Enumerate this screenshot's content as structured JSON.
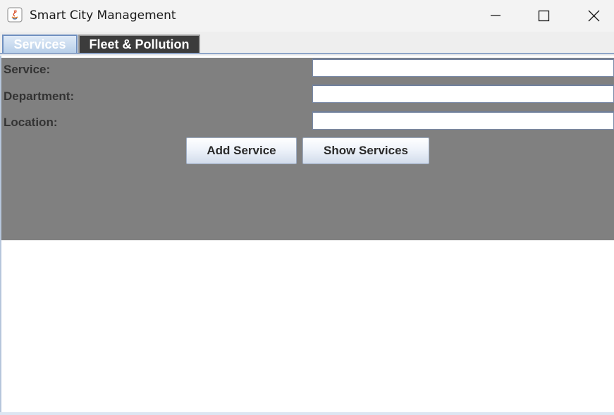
{
  "window": {
    "title": "Smart City Management",
    "icons": [
      "java-app-icon",
      "minimize-icon",
      "maximize-icon",
      "close-icon"
    ]
  },
  "tabs": [
    {
      "label": "Services",
      "selected": true
    },
    {
      "label": "Fleet & Pollution",
      "selected": false
    }
  ],
  "form": {
    "service_label": "Service:",
    "service_value": "",
    "department_label": "Department:",
    "department_value": "",
    "location_label": "Location:",
    "location_value": ""
  },
  "buttons": {
    "add_label": "Add Service",
    "show_label": "Show Services"
  },
  "colors": {
    "form_background": "#808080",
    "selected_tab": "#b8cfe9",
    "other_tab": "#3c3c3c"
  }
}
